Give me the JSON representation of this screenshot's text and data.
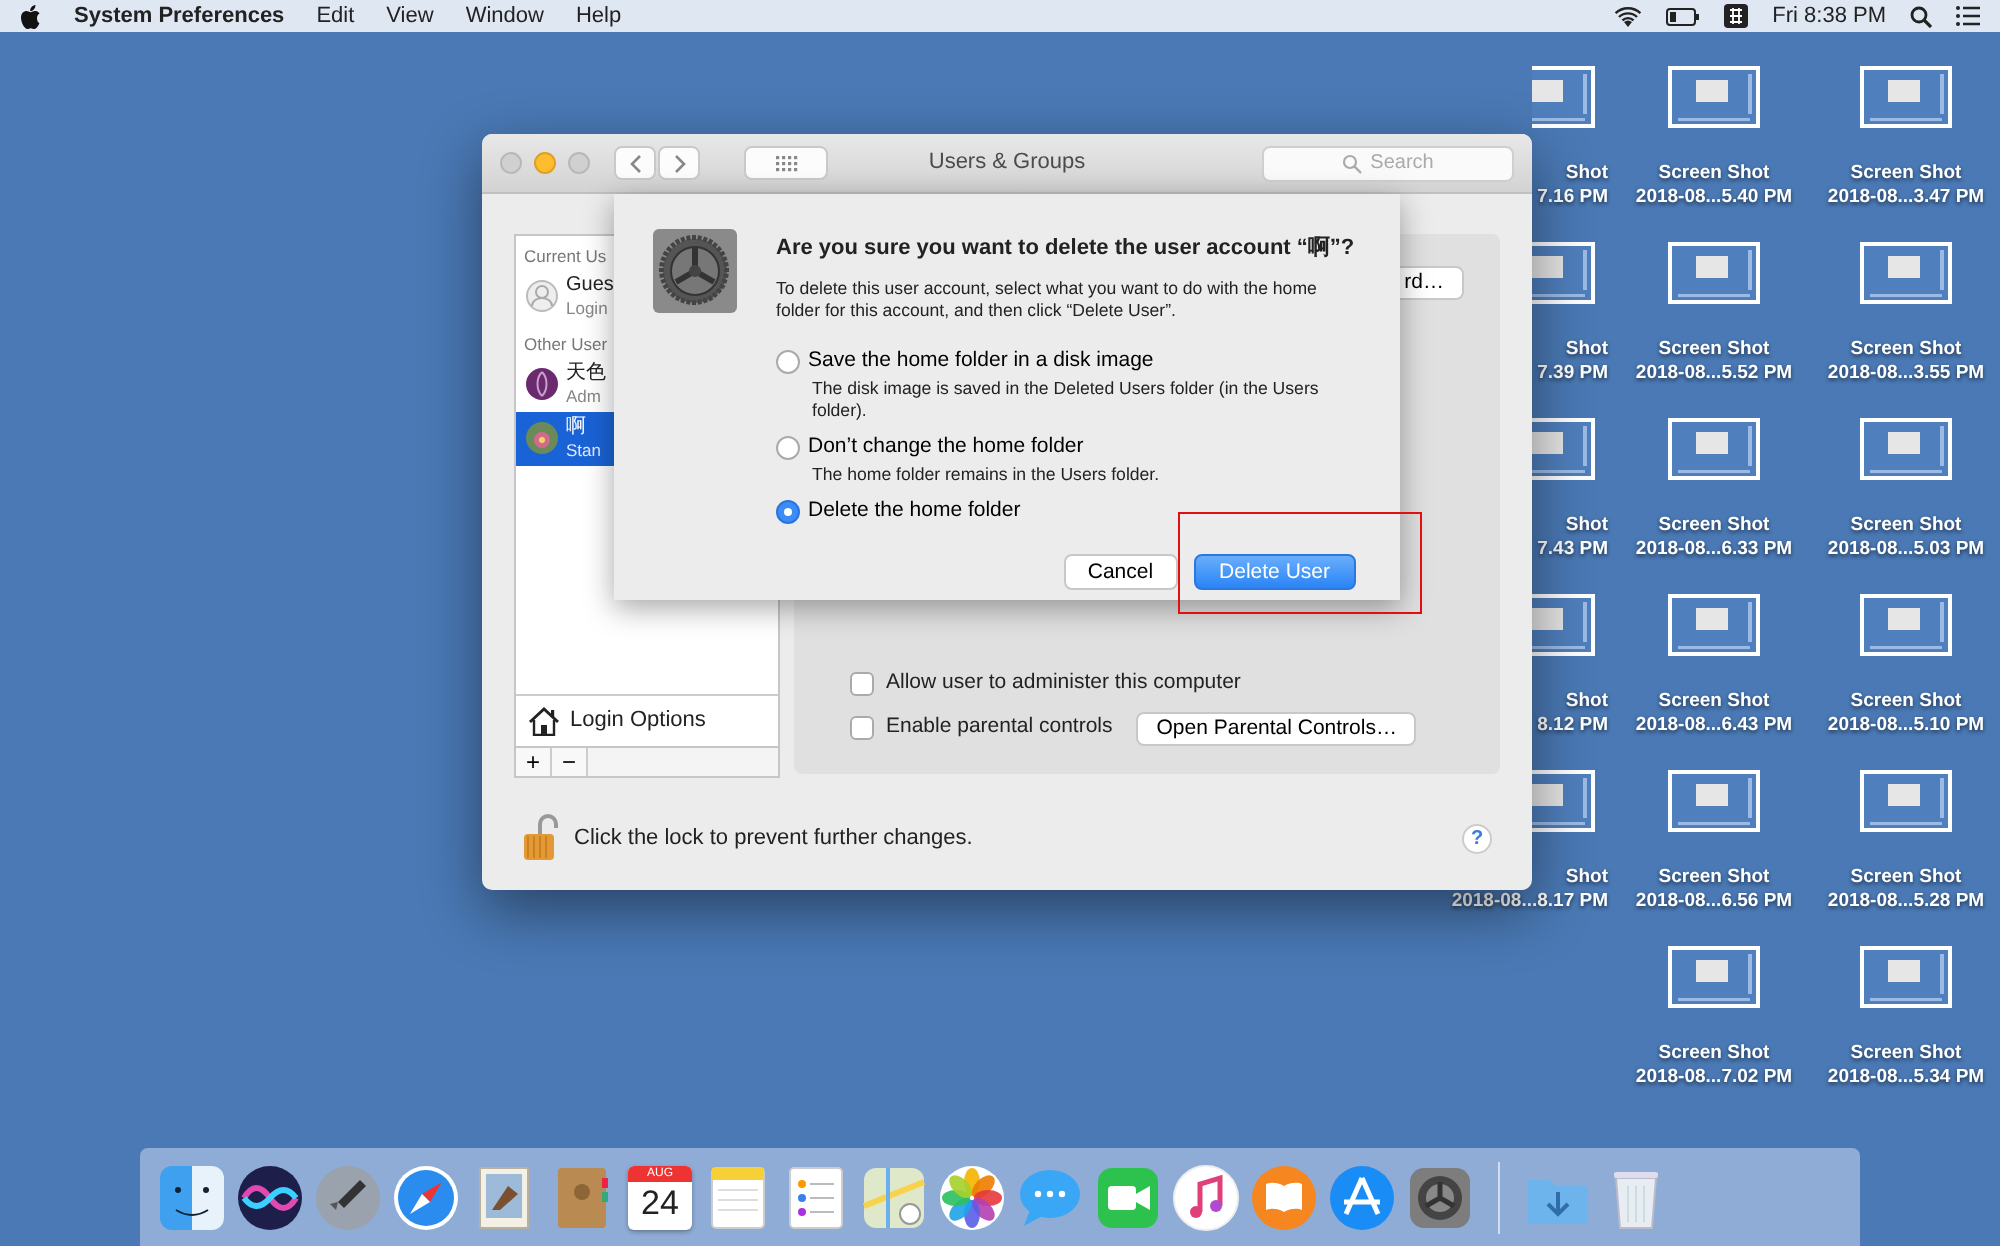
{
  "menu_bar": {
    "app": "System Preferences",
    "menus": [
      "Edit",
      "View",
      "Window",
      "Help"
    ],
    "clock": "Fri 8:38 PM"
  },
  "window": {
    "title": "Users & Groups",
    "search": {
      "placeholder": "Search"
    },
    "sidebar": {
      "sections": [
        {
          "header": "Current Us",
          "users": [
            {
              "name": "Gues",
              "role": "Login",
              "selected": false
            }
          ]
        },
        {
          "header": "Other User",
          "users": [
            {
              "name": "天色",
              "role": "Adm",
              "selected": false
            },
            {
              "name": "啊",
              "role": "Stan",
              "selected": true
            }
          ]
        }
      ],
      "login_options": "Login Options",
      "add": "+",
      "remove": "−"
    },
    "password_button": "rd…",
    "checkboxes": [
      {
        "label": "Allow user to administer this computer",
        "checked": false
      },
      {
        "label": "Enable parental controls",
        "checked": false
      }
    ],
    "parental_button": "Open Parental Controls…",
    "lock_text": "Click the lock to prevent further changes.",
    "help": "?"
  },
  "sheet": {
    "title": "Are you sure you want to delete the user account “啊”?",
    "message": "To delete this user account, select what you want to do with the home folder for this account, and then click “Delete User”.",
    "options": [
      {
        "label": "Save the home folder in a disk image",
        "note": "The disk image is saved in the Deleted Users folder (in the Users folder).",
        "selected": false
      },
      {
        "label": "Don’t change the home folder",
        "note": "The home folder remains in the Users folder.",
        "selected": false
      },
      {
        "label": "Delete the home folder",
        "selected": true
      }
    ],
    "buttons": [
      {
        "label": "Cancel",
        "kind": "secondary"
      },
      {
        "label": "Delete User",
        "kind": "default"
      }
    ]
  },
  "desktop_columns": [
    [
      {
        "line1": "Shot",
        "line2": "7.16 PM"
      },
      {
        "line1": "Shot",
        "line2": "7.39 PM"
      },
      {
        "line1": "Shot",
        "line2": "7.43 PM"
      },
      {
        "line1": "Shot",
        "line2": "8.12 PM"
      },
      {
        "line1": "Shot",
        "line2": "2018-08...8.17 PM"
      }
    ],
    [
      {
        "line1": "Screen Shot",
        "line2": "2018-08...5.40 PM"
      },
      {
        "line1": "Screen Shot",
        "line2": "2018-08...5.52 PM"
      },
      {
        "line1": "Screen Shot",
        "line2": "2018-08...6.33 PM"
      },
      {
        "line1": "Screen Shot",
        "line2": "2018-08...6.43 PM"
      },
      {
        "line1": "Screen Shot",
        "line2": "2018-08...6.56 PM"
      },
      {
        "line1": "Screen Shot",
        "line2": "2018-08...7.02 PM"
      }
    ],
    [
      {
        "line1": "Screen Shot",
        "line2": "2018-08...3.47 PM"
      },
      {
        "line1": "Screen Shot",
        "line2": "2018-08...3.55 PM"
      },
      {
        "line1": "Screen Shot",
        "line2": "2018-08...5.03 PM"
      },
      {
        "line1": "Screen Shot",
        "line2": "2018-08...5.10 PM"
      },
      {
        "line1": "Screen Shot",
        "line2": "2018-08...5.28 PM"
      },
      {
        "line1": "Screen Shot",
        "line2": "2018-08...5.34 PM"
      }
    ]
  ],
  "dock": {
    "calendar_month": "AUG",
    "calendar_day": "24"
  }
}
